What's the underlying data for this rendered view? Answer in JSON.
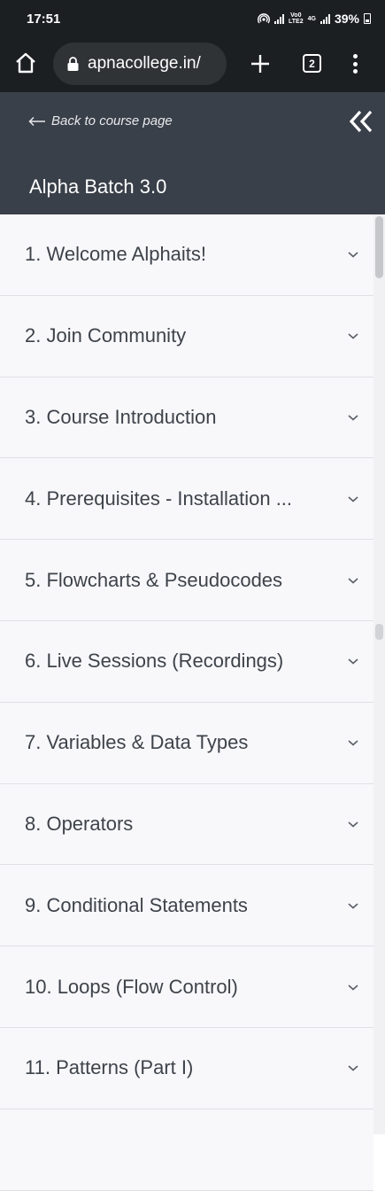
{
  "status_bar": {
    "time": "17:51",
    "net_top": "Vo0",
    "net_bottom": "LTE2",
    "net_gen": "4G",
    "battery": "39%"
  },
  "browser": {
    "url": "apnacollege.in/",
    "tab_count": "2"
  },
  "course": {
    "back_label": "Back to course page",
    "title": "Alpha Batch 3.0"
  },
  "sections": [
    {
      "label": "1. Welcome Alphaits!"
    },
    {
      "label": "2. Join Community"
    },
    {
      "label": "3. Course Introduction"
    },
    {
      "label": "4. Prerequisites - Installation ..."
    },
    {
      "label": "5. Flowcharts & Pseudocodes"
    },
    {
      "label": "6. Live Sessions (Recordings)"
    },
    {
      "label": "7. Variables & Data Types"
    },
    {
      "label": "8. Operators"
    },
    {
      "label": "9. Conditional Statements"
    },
    {
      "label": "10. Loops (Flow Control)"
    },
    {
      "label": "11. Patterns (Part I)"
    },
    {
      "label": ""
    }
  ],
  "colors": {
    "browser_bg": "#1c1f22",
    "header_bg": "#3a404a",
    "list_bg": "#f8f8fb",
    "text": "#3e434a"
  }
}
